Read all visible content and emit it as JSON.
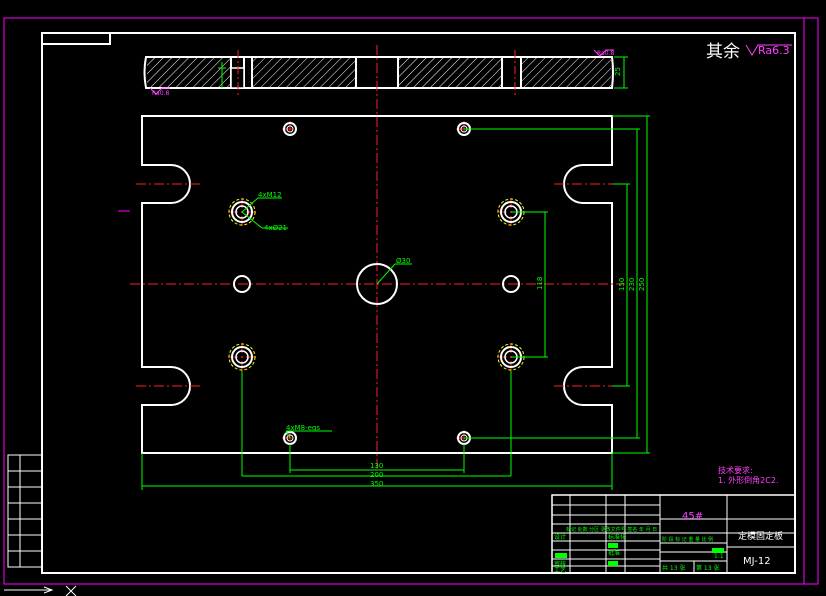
{
  "roughness_note": {
    "prefix": "其余",
    "value": "Ra6.3"
  },
  "section_callouts": {
    "top_right": "Ra0.8",
    "bottom_left": "Ra0.8",
    "height_dim": "25"
  },
  "side_labels": [
    "",
    "",
    "",
    "",
    "",
    "",
    ""
  ],
  "dimensions": {
    "small_hole": "4xM12",
    "counterbore": "4xØ21",
    "center_hole": "Ø30",
    "pin_hole": "4xM8-eqs",
    "v_118": "118",
    "v_150": "150",
    "v_230": "230",
    "v_250": "250",
    "h_130": "130",
    "h_200": "200",
    "h_350": "350"
  },
  "tech_requirements": {
    "title": "技术要求:",
    "line1": "1. 外形倒角2C2."
  },
  "title_block": {
    "material": "45#",
    "part_name": "定模固定板",
    "drawing_no": "MJ-12",
    "scale": "1:1",
    "sheets_total": "共 13 张",
    "sheet_no": "第 13 张",
    "header_row": "标记 处数 分区 更改文件号 签名 年 月 日",
    "stage_header": "阶 段 标 记   重 量   比 例",
    "design_label": "设计",
    "std_label": "标准化",
    "review_label": "审核",
    "process_label": "工艺",
    "approve_label": "批准"
  }
}
